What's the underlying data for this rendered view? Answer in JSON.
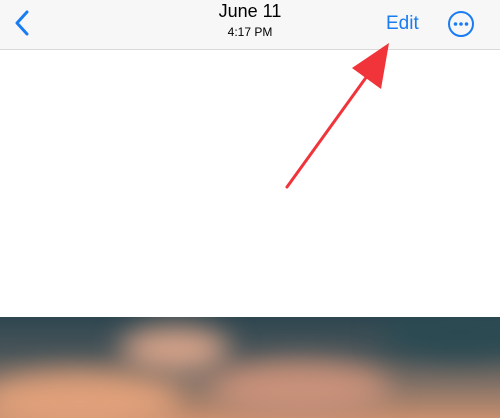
{
  "navbar": {
    "title": "June 11",
    "subtitle": "4:17 PM",
    "edit_label": "Edit"
  },
  "icons": {
    "back": "chevron-left-icon",
    "more": "ellipsis-circle-icon"
  },
  "colors": {
    "accent": "#1a7cf2",
    "navbar_bg": "#f7f7f7",
    "annotation": "#f0343a"
  }
}
